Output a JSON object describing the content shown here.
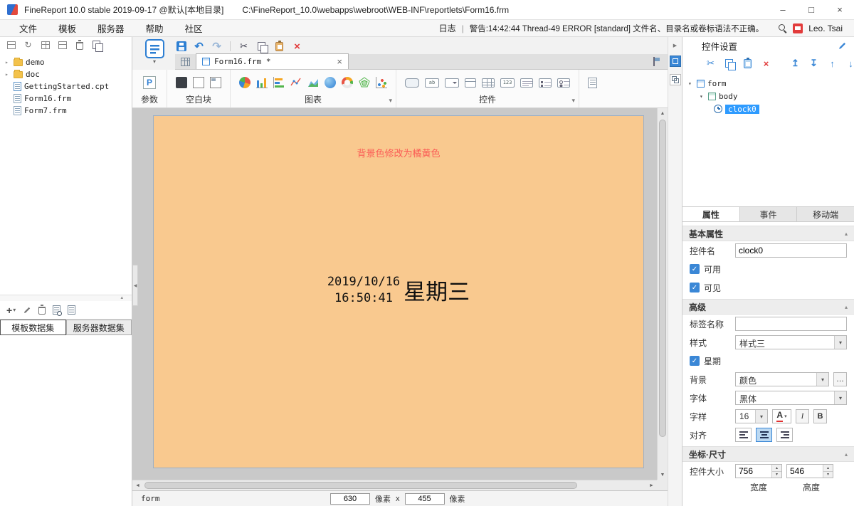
{
  "colors": {
    "accent_blue": "#3a87d6",
    "canvas_orange": "#f9c98f",
    "note_red": "#fb5b55",
    "error_red": "#e23b3b",
    "selection_blue": "#2e9bff"
  },
  "titlebar": {
    "app_title": "FineReport 10.0 stable 2019-09-17 @默认[本地目录]",
    "file_path": "C:\\FineReport_10.0\\webapps\\webroot\\WEB-INF\\reportlets\\Form16.frm"
  },
  "menubar": {
    "items": [
      "文件",
      "模板",
      "服务器",
      "帮助",
      "社区"
    ],
    "log_label": "日志",
    "separator": "|",
    "warning_text": "警告:14:42:44 Thread-49 ERROR [standard] 文件名、目录名或卷标语法不正确。",
    "username": "Leo. Tsai"
  },
  "left_panel": {
    "tree": [
      {
        "label": "demo",
        "type": "folder"
      },
      {
        "label": "doc",
        "type": "folder"
      },
      {
        "label": "GettingStarted.cpt",
        "type": "cpt"
      },
      {
        "label": "Form16.frm",
        "type": "frm"
      },
      {
        "label": "Form7.frm",
        "type": "frm"
      }
    ],
    "dataset_tabs": [
      "模板数据集",
      "服务器数据集"
    ]
  },
  "document_tab": {
    "label": "Form16.frm *"
  },
  "toolbar_groups": {
    "params_label": "参数",
    "blank_label": "空白块",
    "chart_label": "图表",
    "widget_label": "控件"
  },
  "canvas": {
    "note": "背景色修改为橘黄色",
    "clock_date": "2019/10/16",
    "clock_time": "16:50:41",
    "clock_week": "星期三"
  },
  "statusbar": {
    "selection": "form",
    "width": "630",
    "height": "455",
    "unit_w": "像素",
    "times": "x",
    "unit_h": "像素"
  },
  "right_panel": {
    "title": "控件设置",
    "tree": {
      "form": "form",
      "body": "body",
      "widget": "clock0"
    },
    "tabs": [
      "属性",
      "事件",
      "移动端"
    ],
    "basic": {
      "header": "基本属性",
      "name_label": "控件名",
      "name_value": "clock0",
      "enabled_label": "可用",
      "visible_label": "可见"
    },
    "advanced": {
      "header": "高级",
      "tag_label": "标签名称",
      "tag_value": "",
      "style_label": "样式",
      "style_value": "样式三",
      "week_label": "星期",
      "bg_label": "背景",
      "bg_value": "颜色",
      "font_label": "字体",
      "font_value": "黑体",
      "fontstyle_label": "字样",
      "font_size": "16",
      "align_label": "对齐"
    },
    "coords": {
      "header": "坐标·尺寸",
      "size_label": "控件大小",
      "width": "756",
      "height": "546",
      "width_label": "宽度",
      "height_label": "高度"
    }
  },
  "icons": {
    "check": "✓",
    "dropdown": "▾",
    "caret_up": "▴",
    "caret_down": "▾",
    "expand": "▾",
    "collapse": "▸",
    "undo": "↶",
    "redo": "↷",
    "cut": "✂",
    "delete": "×",
    "close": "×",
    "minimize": "–",
    "maximize": "□",
    "move_top": "↥",
    "move_bottom": "↧",
    "move_up": "↑",
    "move_down": "↓",
    "refresh": "↻",
    "plus": "+",
    "ellipsis": "…",
    "scroll_up": "▲",
    "scroll_down": "▼",
    "scroll_left": "◄",
    "scroll_right": "►",
    "panel_left": "◀",
    "panel_right": "▶",
    "param_p": "P",
    "bold": "B",
    "italic": "I",
    "font_color": "A",
    "text_glyph": "ab",
    "number_glyph": "123"
  }
}
